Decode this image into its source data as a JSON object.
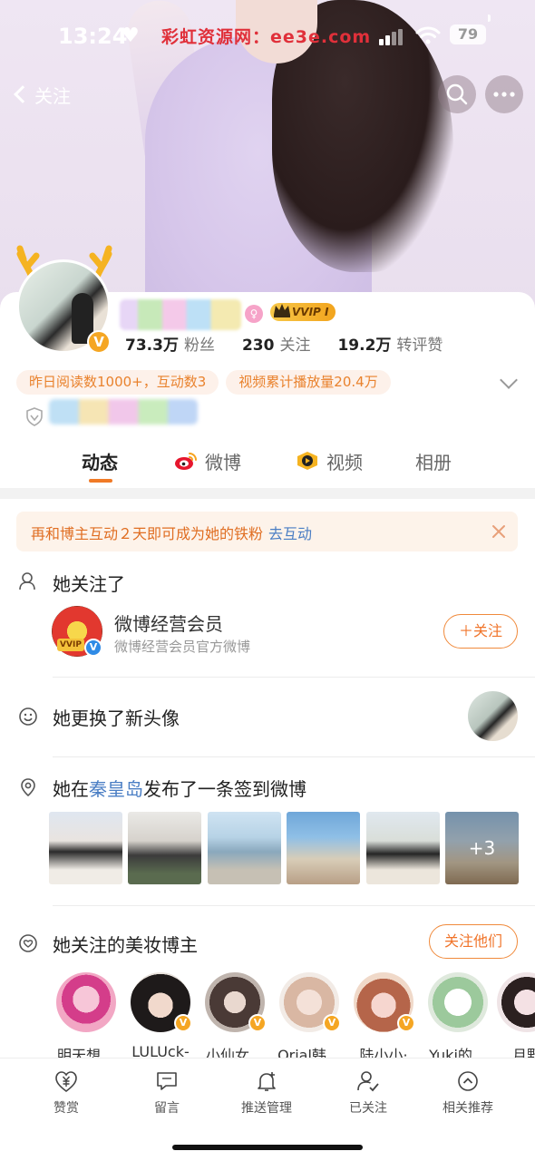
{
  "status_bar": {
    "time": "13:24",
    "watermark": "彩虹资源网：ee3e.com",
    "battery": "79"
  },
  "nav": {
    "back_label": "关注"
  },
  "profile": {
    "stats": [
      {
        "value": "73.3万",
        "label": "粉丝"
      },
      {
        "value": "230",
        "label": "关注"
      },
      {
        "value": "19.2万",
        "label": "转评赞"
      }
    ],
    "vvip_label": "VVIP I",
    "tags": [
      "昨日阅读数1000+，互动数3",
      "视频累计播放量20.4万"
    ]
  },
  "tabs": [
    {
      "label": "动态",
      "active": true
    },
    {
      "label": "微博",
      "icon": "weibo-icon"
    },
    {
      "label": "视频",
      "icon": "video-icon"
    },
    {
      "label": "相册"
    }
  ],
  "banner": {
    "text": "再和博主互动２天即可成为她的铁粉",
    "link": "去互动"
  },
  "feed": {
    "followed": {
      "title": "她关注了",
      "name": "微博经营会员",
      "desc": "微博经营会员官方微博",
      "button": "＋关注"
    },
    "avatar_change": {
      "title": "她更换了新头像"
    },
    "checkin": {
      "prefix": "她在",
      "place": "秦皇岛",
      "suffix": "发布了一条签到微博",
      "more_count": "+3"
    },
    "bloggers": {
      "title": "她关注的美妆博主",
      "button": "关注他们",
      "items": [
        {
          "name": "明天想…"
        },
        {
          "name": "LULUck-"
        },
        {
          "name": "小仙女…"
        },
        {
          "name": "Orial韩…"
        },
        {
          "name": "陆小小·"
        },
        {
          "name": "Yuki的…"
        },
        {
          "name": "月野"
        }
      ]
    }
  },
  "bottom_bar": [
    {
      "label": "赞赏",
      "icon": "yuan-icon"
    },
    {
      "label": "留言",
      "icon": "message-icon"
    },
    {
      "label": "推送管理",
      "icon": "bell-icon"
    },
    {
      "label": "已关注",
      "icon": "user-check-icon"
    },
    {
      "label": "相关推荐",
      "icon": "chevron-up-circle-icon"
    }
  ]
}
